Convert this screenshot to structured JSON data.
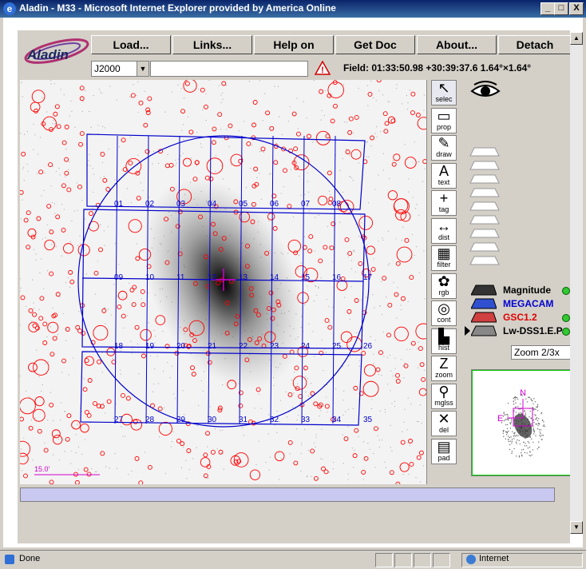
{
  "window": {
    "title": "Aladin - M33 - Microsoft Internet Explorer provided by America Online",
    "min": "_",
    "max": "□",
    "close": "X"
  },
  "logo_text": "Aladin",
  "toolbar": {
    "buttons": [
      "Load...",
      "Links...",
      "Help on",
      "Get Doc",
      "About...",
      "Detach"
    ]
  },
  "frame_select": "J2000",
  "target_input": "",
  "field_info": "Field: 01:33:50.98 +30:39:37.6   1.64°×1.64°",
  "scale_label": "15.0'",
  "tools": [
    {
      "id": "select",
      "label": "selec",
      "glyph": "↖"
    },
    {
      "id": "prop",
      "label": "prop",
      "glyph": "▭"
    },
    {
      "id": "draw",
      "label": "draw",
      "glyph": "✎"
    },
    {
      "id": "text",
      "label": "text",
      "glyph": "A"
    },
    {
      "id": "tag",
      "label": "tag",
      "glyph": "+"
    },
    {
      "id": "dist",
      "label": "dist",
      "glyph": "↔"
    },
    {
      "id": "filter",
      "label": "filter",
      "glyph": "▦"
    },
    {
      "id": "rgb",
      "label": "rgb",
      "glyph": "✿"
    },
    {
      "id": "cont",
      "label": "cont",
      "glyph": "◎"
    },
    {
      "id": "hist",
      "label": "hist",
      "glyph": "▙"
    },
    {
      "id": "zoom",
      "label": "zoom",
      "glyph": "Z"
    },
    {
      "id": "mglss",
      "label": "mglss",
      "glyph": "⚲"
    },
    {
      "id": "del",
      "label": "del",
      "glyph": "✕"
    },
    {
      "id": "pad",
      "label": "pad",
      "glyph": "▤"
    }
  ],
  "layers": [
    {
      "name": "Magnitude",
      "color": "#000000"
    },
    {
      "name": "MEGACAM",
      "color": "#0000d0"
    },
    {
      "name": "GSC1.2",
      "color": "#e00000"
    },
    {
      "name": "Lw-DSS1.E.P",
      "color": "#000000"
    }
  ],
  "zoom_select": "Zoom 2/3x",
  "overview": {
    "north": "N",
    "east": "E"
  },
  "ccd_numbers": [
    "01",
    "02",
    "03",
    "04",
    "05",
    "06",
    "07",
    "08",
    "09",
    "10",
    "11",
    "12",
    "13",
    "14",
    "15",
    "16",
    "17",
    "18",
    "19",
    "20",
    "21",
    "22",
    "23",
    "24",
    "25",
    "26",
    "27",
    "28",
    "29",
    "30",
    "31",
    "32",
    "33",
    "34",
    "35"
  ],
  "status": {
    "left": "Done",
    "zone": "Internet"
  },
  "colors": {
    "catalog": "#ff0000",
    "mosaic": "#0000cc",
    "overview_frame": "#00cc00"
  }
}
